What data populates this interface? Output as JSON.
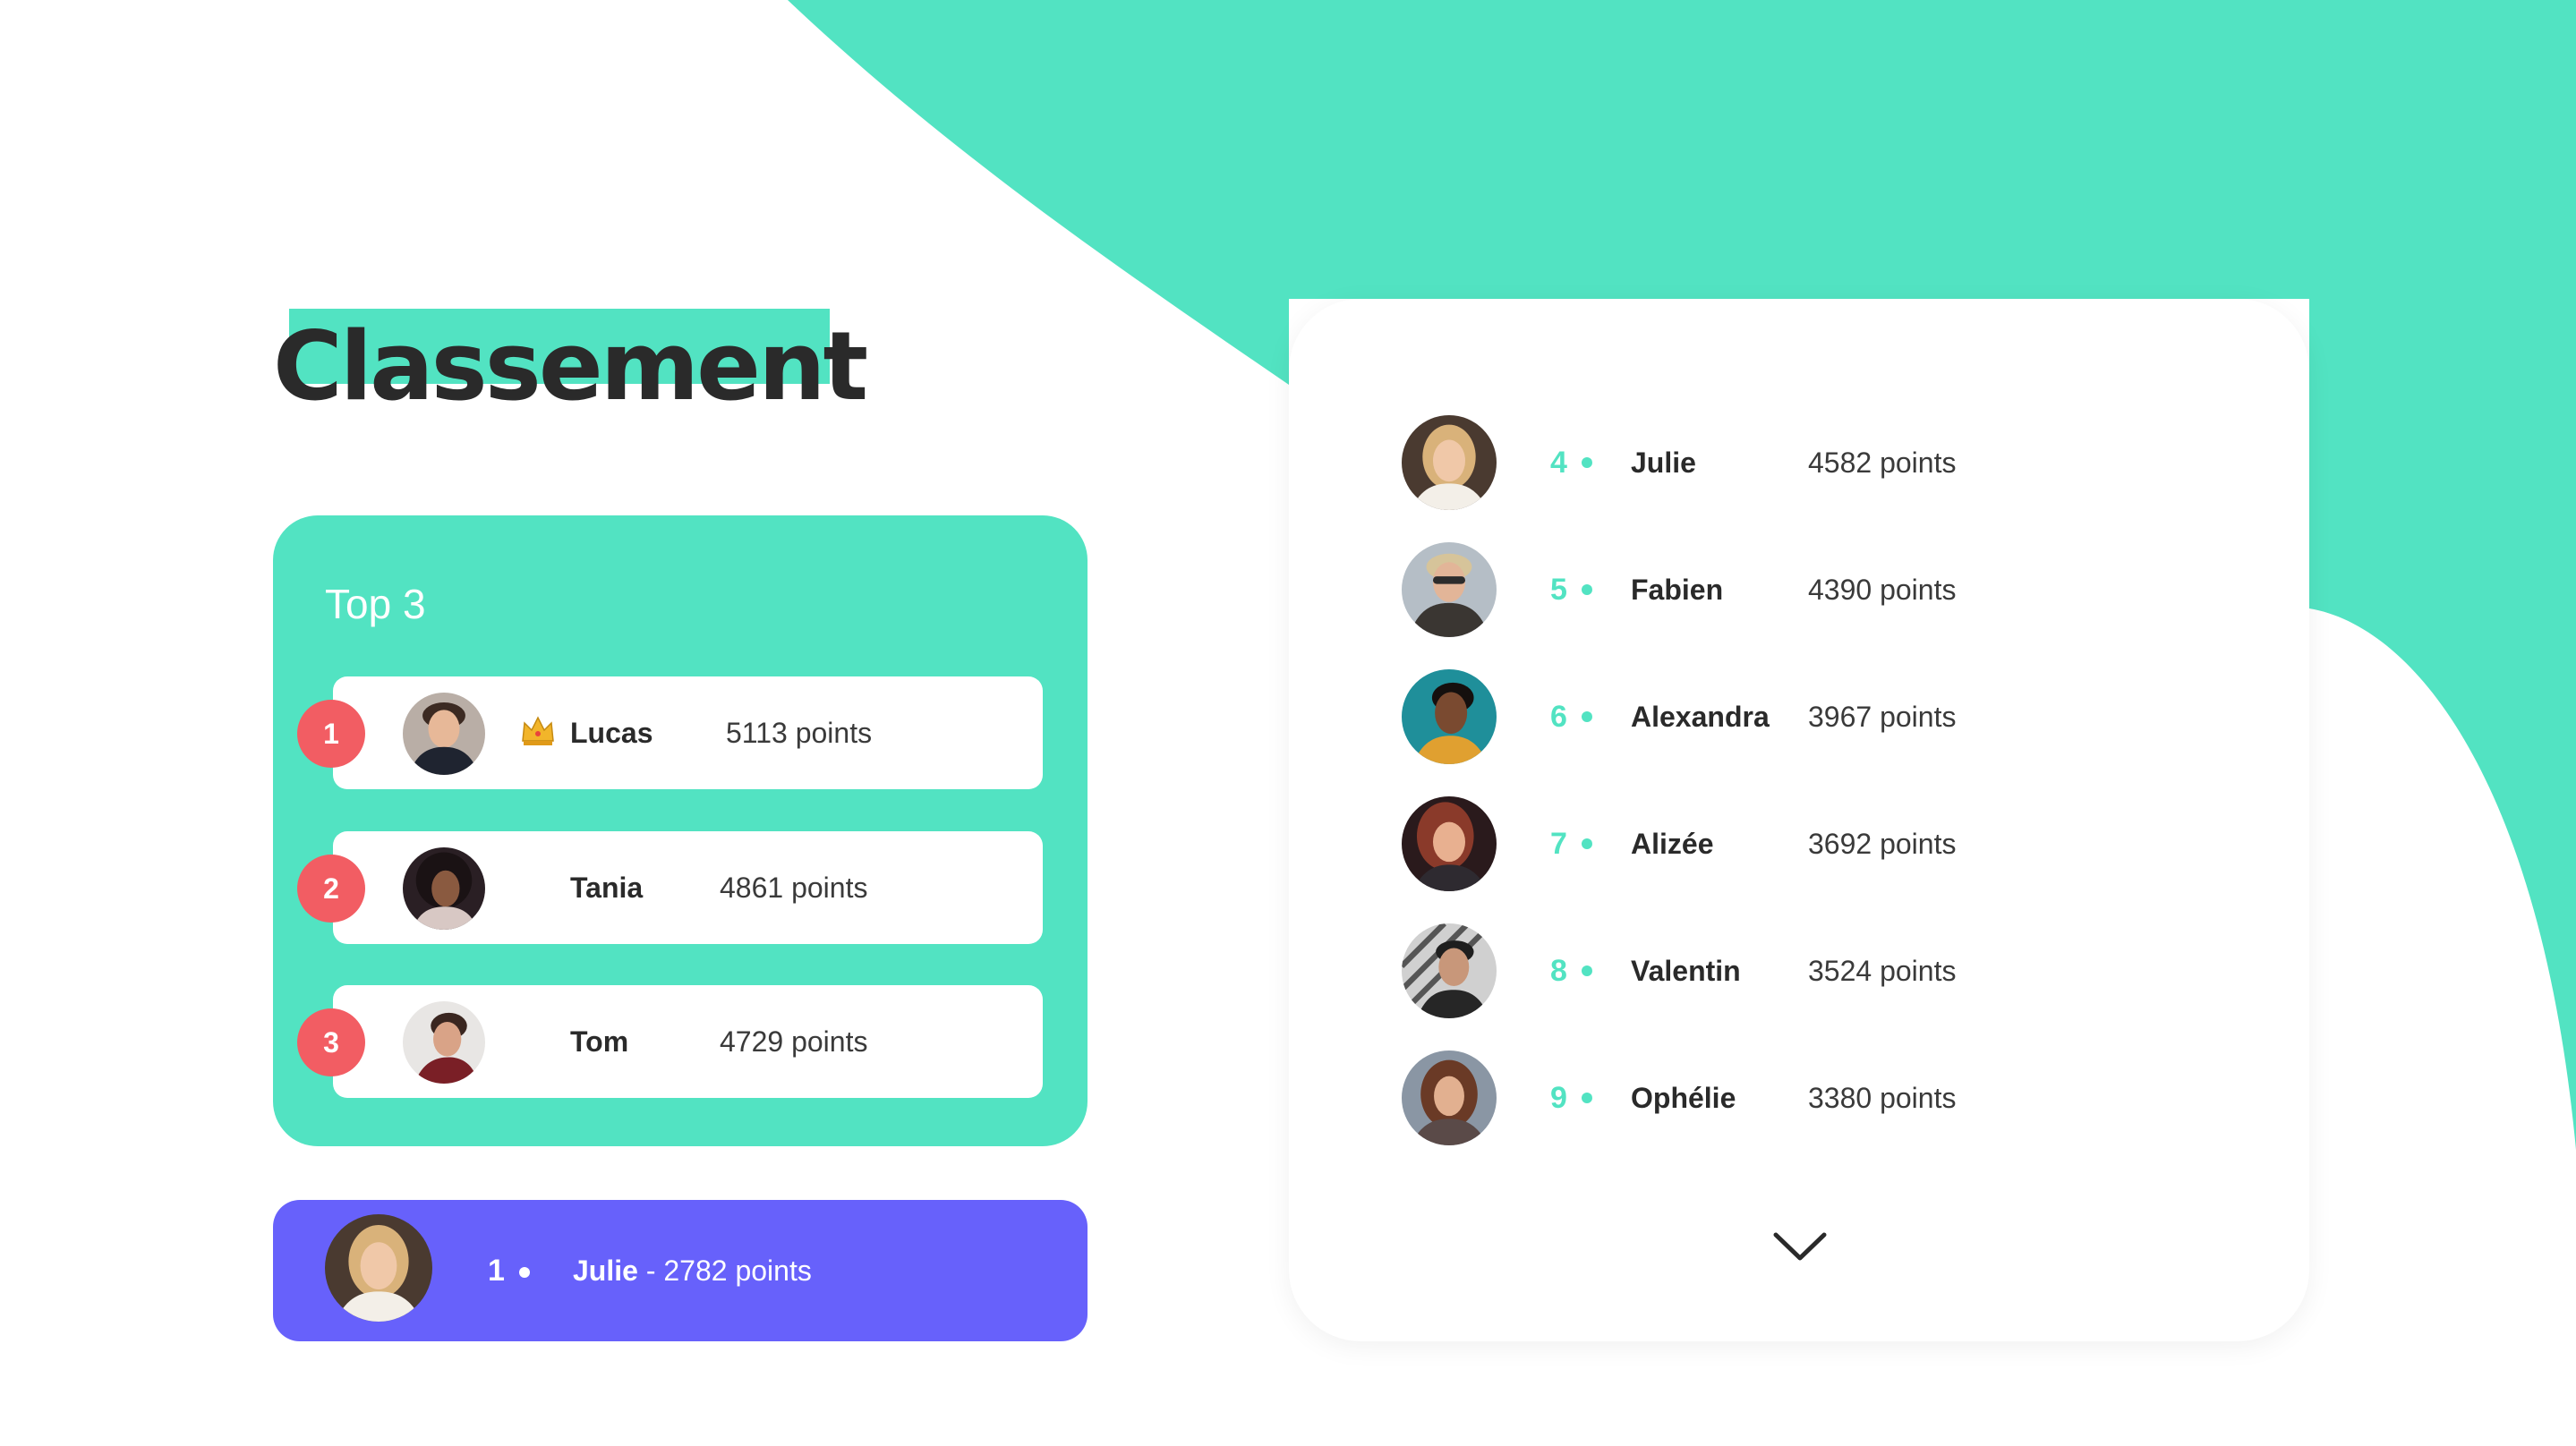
{
  "colors": {
    "accent": "#52e3c2",
    "purple": "#6761fb",
    "badge_red": "#f25d63",
    "text_dark": "#2a2a2a",
    "white": "#ffffff"
  },
  "page": {
    "title": "Classement"
  },
  "top3": {
    "heading": "Top 3",
    "entries": [
      {
        "rank": "1",
        "name": "Lucas",
        "points": "5113 points",
        "crown": true,
        "avatar": "avatar-lucas"
      },
      {
        "rank": "2",
        "name": "Tania",
        "points": "4861 points",
        "crown": false,
        "avatar": "avatar-tania"
      },
      {
        "rank": "3",
        "name": "Tom",
        "points": "4729 points",
        "crown": false,
        "avatar": "avatar-tom"
      }
    ]
  },
  "current_user": {
    "rank": "1",
    "name": "Julie",
    "separator": " - ",
    "points": "2782 points",
    "avatar": "avatar-julie"
  },
  "leaderboard": {
    "entries": [
      {
        "rank": "4",
        "name": "Julie",
        "points": "4582 points",
        "avatar": "avatar-julie"
      },
      {
        "rank": "5",
        "name": "Fabien",
        "points": "4390 points",
        "avatar": "avatar-fabien"
      },
      {
        "rank": "6",
        "name": "Alexandra",
        "points": "3967 points",
        "avatar": "avatar-alexandra"
      },
      {
        "rank": "7",
        "name": "Alizée",
        "points": "3692 points",
        "avatar": "avatar-alizee"
      },
      {
        "rank": "8",
        "name": "Valentin",
        "points": "3524 points",
        "avatar": "avatar-valentin"
      },
      {
        "rank": "9",
        "name": "Ophélie",
        "points": "3380 points",
        "avatar": "avatar-ophelie"
      }
    ],
    "more_icon": "chevron-down-icon"
  }
}
